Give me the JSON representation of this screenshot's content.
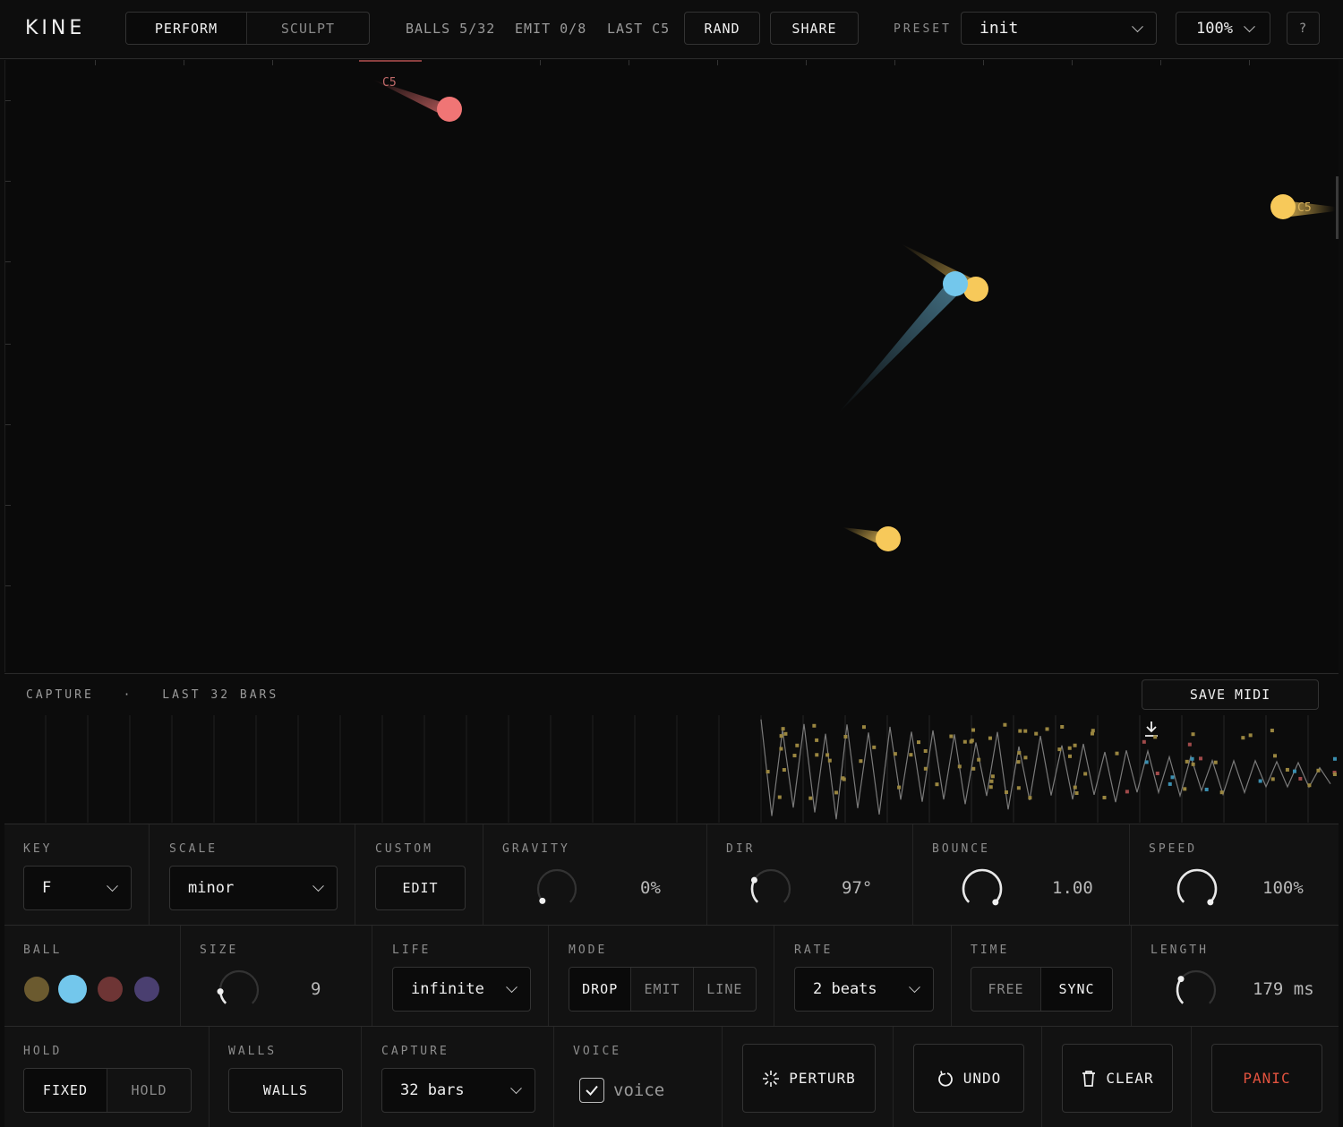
{
  "app": {
    "logo": "KINE"
  },
  "topbar": {
    "tabs": [
      {
        "label": "PERFORM",
        "active": true
      },
      {
        "label": "SCULPT",
        "active": false
      }
    ],
    "balls": "BALLS 5/32",
    "emit": "EMIT 0/8",
    "last": "LAST C5",
    "rand_label": "RAND",
    "share_label": "SHARE",
    "preset_label": "PRESET",
    "preset_value": "init",
    "zoom_value": "100%",
    "help_label": "?"
  },
  "stage": {
    "balls": [
      {
        "color": "#f07575",
        "note": "C5",
        "show_label": true
      },
      {
        "color": "#f7c95a",
        "note": "C5",
        "show_label": true
      },
      {
        "color": "#73c7ec",
        "note": "",
        "show_label": false
      },
      {
        "color": "#f7c95a",
        "note": "",
        "show_label": false
      },
      {
        "color": "#f7c95a",
        "note": "",
        "show_label": false
      }
    ]
  },
  "capture": {
    "title": "CAPTURE",
    "separator": "·",
    "range": "LAST 32 BARS",
    "save_label": "SAVE MIDI",
    "colors": {
      "yellow": "#9a8640",
      "blue": "#3b8fb0",
      "red": "#a04a4a",
      "line": "#7a7a7a"
    }
  },
  "controls": {
    "key": {
      "label": "KEY",
      "value": "F"
    },
    "scale": {
      "label": "SCALE",
      "value": "minor"
    },
    "custom": {
      "label": "CUSTOM",
      "button": "EDIT"
    },
    "gravity": {
      "label": "GRAVITY",
      "value": "0%",
      "level": 0.0
    },
    "dir": {
      "label": "DIR",
      "value": "97°",
      "level": 0.27
    },
    "bounce": {
      "label": "BOUNCE",
      "value": "1.00",
      "level": 1.0
    },
    "speed": {
      "label": "SPEED",
      "value": "100%",
      "level": 1.0
    },
    "ball": {
      "label": "BALL",
      "swatches": [
        "#6b5a2f",
        "#73c7ec",
        "#6e3535",
        "#4a3f70"
      ],
      "selected": 1
    },
    "size": {
      "label": "SIZE",
      "value": "9",
      "level": 0.15
    },
    "life": {
      "label": "LIFE",
      "value": "infinite"
    },
    "mode": {
      "label": "MODE",
      "options": [
        "DROP",
        "EMIT",
        "LINE"
      ],
      "selected": 0
    },
    "rate": {
      "label": "RATE",
      "value": "2 beats"
    },
    "time": {
      "label": "TIME",
      "options": [
        "FREE",
        "SYNC"
      ],
      "selected": 1
    },
    "length": {
      "label": "LENGTH",
      "value": "179 ms",
      "level": 0.3
    },
    "hold": {
      "label": "HOLD",
      "options": [
        "FIXED",
        "HOLD"
      ],
      "selected": 0
    },
    "walls": {
      "label": "WALLS",
      "button": "WALLS"
    },
    "capture": {
      "label": "CAPTURE",
      "value": "32 bars"
    },
    "voice": {
      "label": "VOICE",
      "checkbox_label": "voice",
      "checked": true
    },
    "perturb_label": "PERTURB",
    "undo_label": "UNDO",
    "clear_label": "CLEAR",
    "panic_label": "PANIC",
    "panic_color": "#e2533f"
  }
}
